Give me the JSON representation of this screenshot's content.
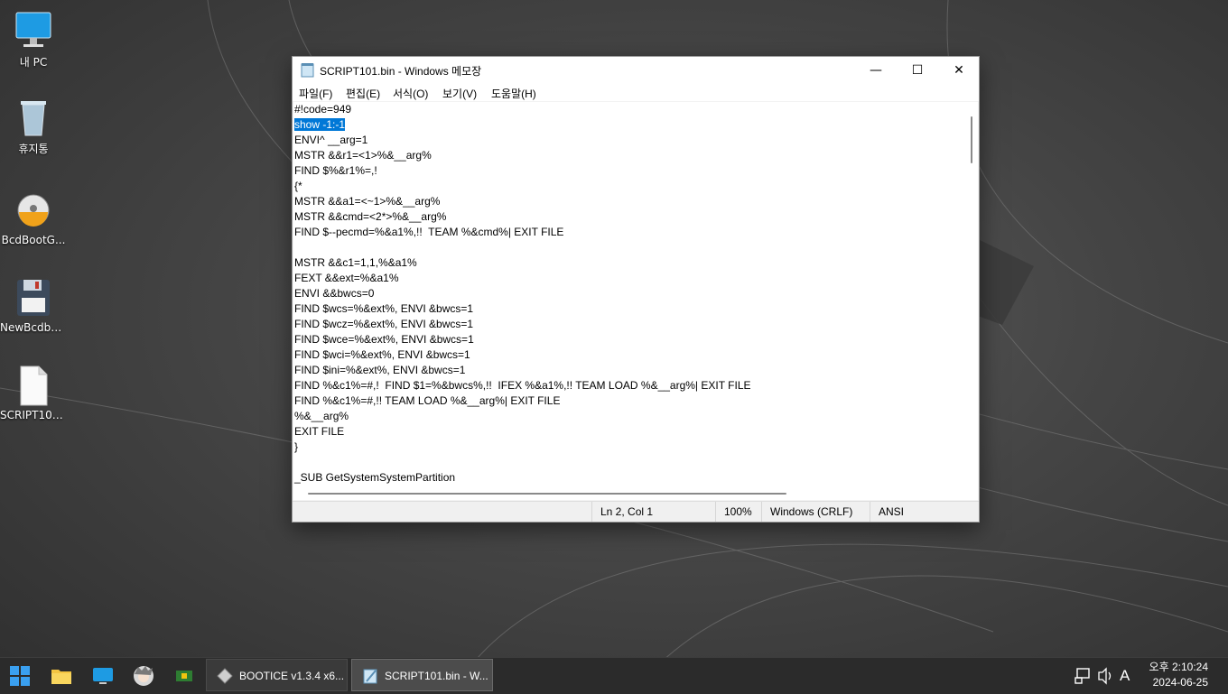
{
  "desktop": {
    "icons": [
      {
        "label": "내 PC",
        "icon": "monitor-icon"
      },
      {
        "label": "휴지통",
        "icon": "recycle-bin-icon"
      },
      {
        "label": "BcdBootG...",
        "icon": "disk-app-icon"
      },
      {
        "label": "NewBcdbo...",
        "icon": "floppy-icon"
      },
      {
        "label": "SCRIPT101...",
        "icon": "file-icon"
      }
    ]
  },
  "window": {
    "title": "SCRIPT101.bin - Windows 메모장",
    "controls": {
      "minimize": "—",
      "maximize": "☐",
      "close": "✕"
    },
    "menu": [
      "파일(F)",
      "편집(E)",
      "서식(O)",
      "보기(V)",
      "도움말(H)"
    ],
    "lines": [
      "#!code=949",
      "show -1:-1",
      "ENVI^ __arg=1",
      "MSTR &&r1=<1>%&__arg%",
      "FIND $%&r1%=,!",
      "{*",
      "MSTR &&a1=<~1>%&__arg%",
      "MSTR &&cmd=<2*>%&__arg%",
      "FIND $--pecmd=%&a1%,!!  TEAM %&cmd%| EXIT FILE",
      "",
      "MSTR &&c1=1,1,%&a1%",
      "FEXT &&ext=%&a1%",
      "ENVI &&bwcs=0",
      "FIND $wcs=%&ext%, ENVI &bwcs=1",
      "FIND $wcz=%&ext%, ENVI &bwcs=1",
      "FIND $wce=%&ext%, ENVI &bwcs=1",
      "FIND $wci=%&ext%, ENVI &bwcs=1",
      "FIND $ini=%&ext%, ENVI &bwcs=1",
      "FIND %&c1%=#,!  FIND $1=%&bwcs%,!!  IFEX %&a1%,!! TEAM LOAD %&__arg%| EXIT FILE",
      "FIND %&c1%=#,!! TEAM LOAD %&__arg%| EXIT FILE",
      "%&__arg%",
      "EXIT FILE",
      "}",
      "",
      "_SUB GetSystemSystemPartition"
    ],
    "selected_line": "show -1:-1",
    "status": {
      "position": "Ln 2, Col 1",
      "zoom": "100%",
      "line_ending": "Windows (CRLF)",
      "encoding": "ANSI"
    }
  },
  "taskbar": {
    "pinned": [
      "start-icon",
      "file-explorer-icon",
      "desktop-icon",
      "character-app-icon",
      "chip-app-icon"
    ],
    "tasks": [
      {
        "label": "BOOTICE v1.3.4 x6...",
        "active": false
      },
      {
        "label": "SCRIPT101.bin - W...",
        "active": true
      }
    ],
    "tray": {
      "ime": "A"
    },
    "clock": {
      "time": "오후 2:10:24",
      "date": "2024-06-25"
    }
  },
  "colors": {
    "selection": "#0078d7",
    "taskbar": "#2b2b2b"
  }
}
